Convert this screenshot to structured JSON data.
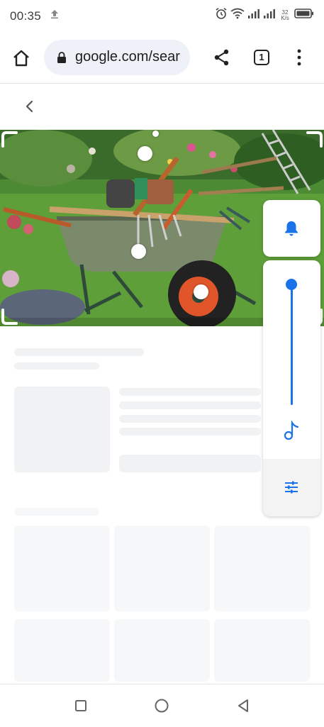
{
  "status_bar": {
    "time": "00:35",
    "net_speed_value": "32",
    "net_speed_unit": "K/s",
    "icons": [
      "upload-icon",
      "alarm-icon",
      "wifi-icon",
      "signal-icon",
      "signal-icon",
      "battery-icon"
    ]
  },
  "toolbar": {
    "url": "google.com/sear",
    "tab_count": "1",
    "icons": [
      "home-icon",
      "lock-icon",
      "share-icon",
      "tabs-icon",
      "more-vert-icon"
    ]
  },
  "page": {
    "back_icon": "chevron-left-icon",
    "image_subject": "wheelbarrow with garden tools on lawn"
  },
  "volume_panel": {
    "level": 1.0,
    "icons": [
      "bell-icon",
      "music-note-icon",
      "tune-icon"
    ],
    "accent": "#1a73e8"
  },
  "nav_bar": {
    "icons": [
      "recents-square-icon",
      "home-circle-icon",
      "back-triangle-icon"
    ]
  }
}
